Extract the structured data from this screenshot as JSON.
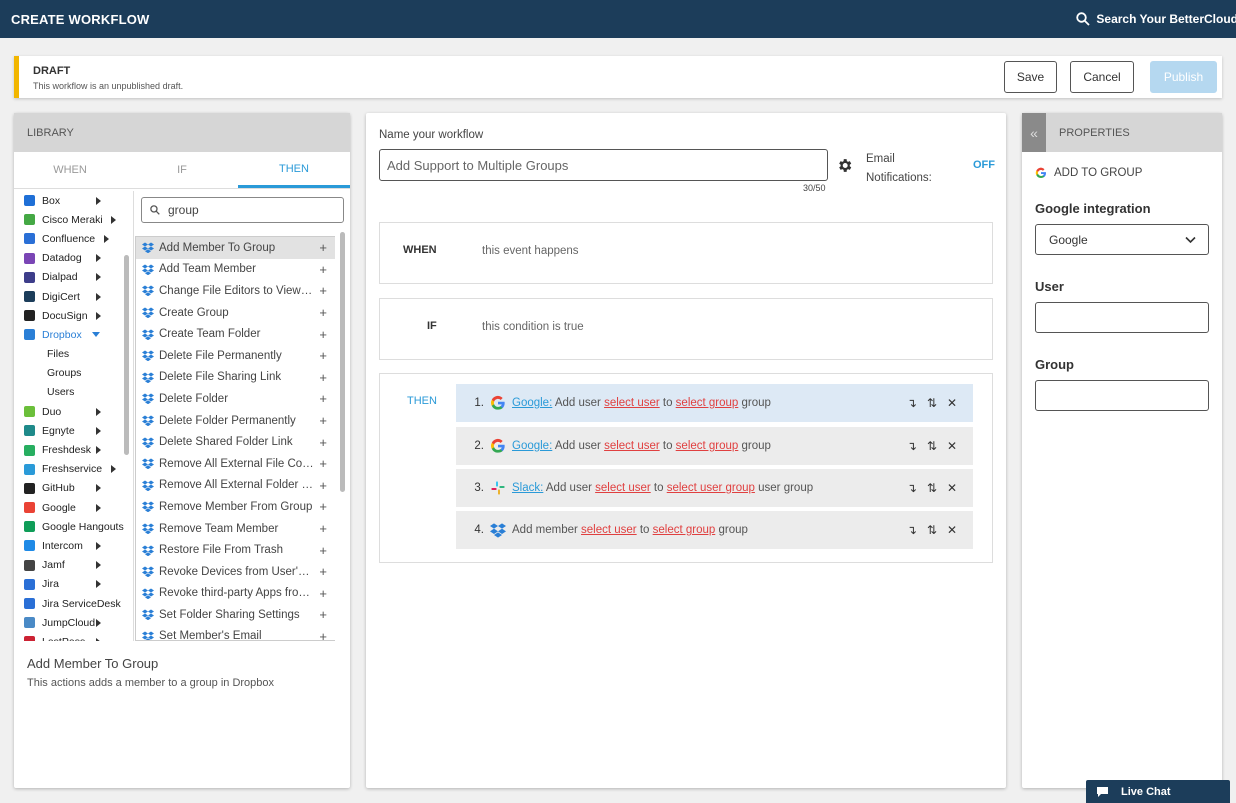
{
  "header": {
    "title": "CREATE WORKFLOW",
    "search": "Search Your BetterCloud"
  },
  "draft": {
    "status": "DRAFT",
    "message": "This workflow is an unpublished draft.",
    "save": "Save",
    "cancel": "Cancel",
    "publish": "Publish"
  },
  "library": {
    "title": "LIBRARY",
    "tabs": [
      "WHEN",
      "IF",
      "THEN"
    ],
    "search_value": "group",
    "integrations": [
      {
        "label": "Box",
        "color": "#1f6fd6"
      },
      {
        "label": "Cisco Meraki",
        "color": "#44a844"
      },
      {
        "label": "Confluence",
        "color": "#2a6fd6"
      },
      {
        "label": "Datadog",
        "color": "#7a45b5"
      },
      {
        "label": "Dialpad",
        "color": "#3d3d8a"
      },
      {
        "label": "DigiCert",
        "color": "#1c3d5a"
      },
      {
        "label": "DocuSign",
        "color": "#222222"
      },
      {
        "label": "Dropbox",
        "color": "#2a7fd6"
      },
      {
        "label": "Files"
      },
      {
        "label": "Groups"
      },
      {
        "label": "Users"
      },
      {
        "label": "Duo",
        "color": "#6bbf3a"
      },
      {
        "label": "Egnyte",
        "color": "#1f8a8a"
      },
      {
        "label": "Freshdesk",
        "color": "#27ae60"
      },
      {
        "label": "Freshservice",
        "color": "#2a9ad8"
      },
      {
        "label": "GitHub",
        "color": "#222222"
      },
      {
        "label": "Google",
        "color": "#ea4335"
      },
      {
        "label": "Google Hangouts",
        "color": "#0f9d58"
      },
      {
        "label": "Intercom",
        "color": "#1f8ae6"
      },
      {
        "label": "Jamf",
        "color": "#444444"
      },
      {
        "label": "Jira",
        "color": "#2a6fd6"
      },
      {
        "label": "Jira ServiceDesk",
        "color": "#2a6fd6"
      },
      {
        "label": "JumpCloud",
        "color": "#4a8ac6"
      },
      {
        "label": "LastPass",
        "color": "#cc2233"
      }
    ],
    "actions": [
      "Add Member To Group",
      "Add Team Member",
      "Change File Editors to Viewers",
      "Create Group",
      "Create Team Folder",
      "Delete File Permanently",
      "Delete File Sharing Link",
      "Delete Folder",
      "Delete Folder Permanently",
      "Delete Shared Folder Link",
      "Remove All External File Collaborators",
      "Remove All External Folder Collaborators",
      "Remove Member From Group",
      "Remove Team Member",
      "Restore File From Trash",
      "Revoke Devices from User's Account",
      "Revoke third-party Apps from User",
      "Set Folder Sharing Settings",
      "Set Member's Email"
    ],
    "selected_title": "Add Member To Group",
    "selected_desc": "This actions adds a member to a group in Dropbox"
  },
  "workflow": {
    "name_label": "Name your workflow",
    "name_value": "Add Support to Multiple Groups",
    "char_count": "30/50",
    "email_label": "Email Notifications:",
    "email_state": "OFF",
    "when_key": "WHEN",
    "when_val": "this event happens",
    "if_key": "IF",
    "if_val": "this condition is true",
    "then_key": "THEN",
    "steps": [
      {
        "num": "1.",
        "app": "Google:",
        "t1": " Add user ",
        "a": "select user",
        "t2": " to ",
        "b": "select group",
        "t3": " group"
      },
      {
        "num": "2.",
        "app": "Google:",
        "t1": " Add user ",
        "a": "select user",
        "t2": " to ",
        "b": "select group",
        "t3": " group"
      },
      {
        "num": "3.",
        "app": "Slack:",
        "t1": " Add user ",
        "a": "select user",
        "t2": " to ",
        "b": "select user group",
        "t3": " user group"
      },
      {
        "num": "4.",
        "app": "",
        "t1": "Add member ",
        "a": "select user",
        "t2": " to ",
        "b": "select group",
        "t3": " group"
      }
    ]
  },
  "properties": {
    "title": "PROPERTIES",
    "action": "ADD TO GROUP",
    "integration_label": "Google integration",
    "integration_value": "Google",
    "user_label": "User",
    "group_label": "Group"
  },
  "livechat": "Live Chat"
}
